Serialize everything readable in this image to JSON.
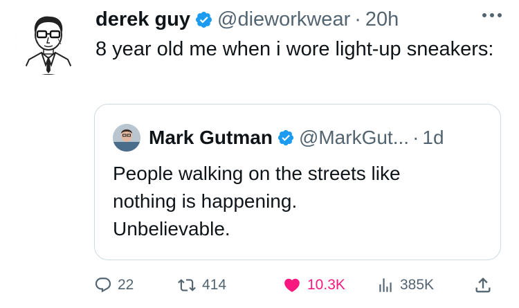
{
  "tweet": {
    "author": {
      "display_name": "derek guy",
      "handle": "@dieworkwear",
      "verified": true
    },
    "separator": "·",
    "time": "20h",
    "text": "8 year old me when i wore light-up sneakers:",
    "more_icon": "ellipsis-icon"
  },
  "quote": {
    "author": {
      "display_name": "Mark Gutman",
      "handle": "@MarkGut...",
      "verified": true
    },
    "separator": "·",
    "time": "1d",
    "lines": [
      "People walking on the streets like",
      "nothing is happening.",
      "Unbelievable."
    ]
  },
  "actions": {
    "reply": {
      "icon": "reply-bubble-icon",
      "count": "22"
    },
    "retweet": {
      "icon": "retweet-icon",
      "count": "414"
    },
    "like": {
      "icon": "heart-icon",
      "count": "10.3K",
      "active": true
    },
    "views": {
      "icon": "views-bar-chart-icon",
      "count": "385K"
    },
    "share": {
      "icon": "share-upload-icon"
    }
  },
  "colors": {
    "text_primary": "#0f1419",
    "text_secondary": "#536471",
    "verified_blue": "#1d9bf0",
    "like_pink": "#f91880",
    "border": "#cfd9de"
  }
}
